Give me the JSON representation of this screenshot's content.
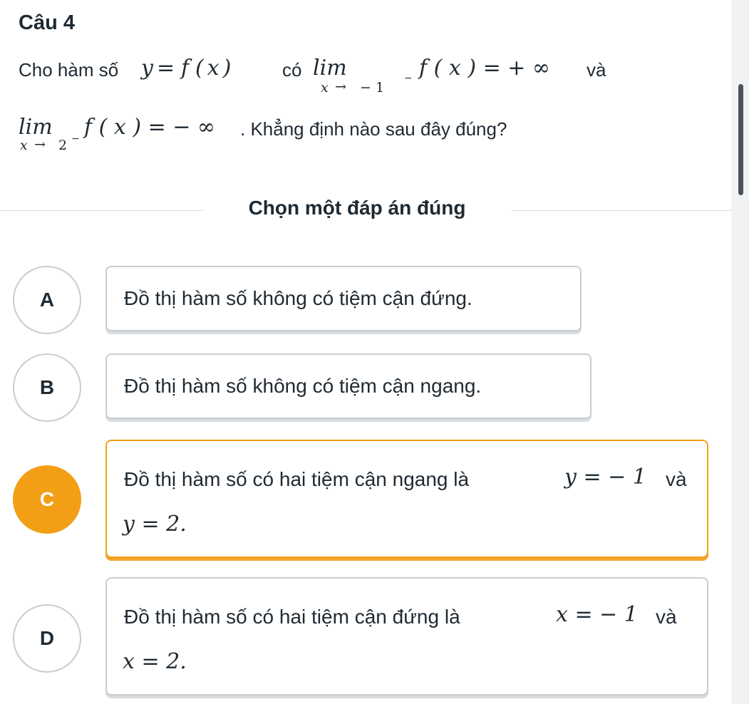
{
  "question": {
    "title": "Câu 4",
    "line1": {
      "prefix": "Cho hàm số",
      "func_y": "y",
      "func_eq": "=",
      "func_f": "f",
      "func_paren": "(x)",
      "connector": "có",
      "lim_word": "lim",
      "lim_sub_var": "x",
      "lim_sub_arrow": "→",
      "lim_sub_val": "− 1",
      "lim_sub_sign": "−",
      "expr": "f ( x ) = + ∞",
      "suffix": "và"
    },
    "line2": {
      "lim_word": "lim",
      "lim_sub_var": "x",
      "lim_sub_arrow": "→",
      "lim_sub_val": "2",
      "lim_sub_sign": "−",
      "expr": "f ( x ) = − ∞",
      "suffix": ". Khẳng định nào sau đây đúng?"
    }
  },
  "prompt": "Chọn một đáp án đúng",
  "options": [
    {
      "letter": "A",
      "text": "Đồ thị hàm số không có tiệm cận đứng.",
      "selected": false
    },
    {
      "letter": "B",
      "text": "Đồ thị hàm số không có tiệm cận ngang.",
      "selected": false
    },
    {
      "letter": "C",
      "text": "Đồ thị hàm số có hai tiệm cận ngang là",
      "math1": "y = − 1",
      "conj": "và",
      "math2": "y = 2.",
      "selected": true
    },
    {
      "letter": "D",
      "text": "Đồ thị hàm số có hai tiệm cận đứng là",
      "math1": "x = − 1",
      "conj": "và",
      "math2": "x = 2.",
      "selected": false
    }
  ],
  "colors": {
    "accent": "#f29f16",
    "border": "#c8cdd2",
    "text": "#1f2a33"
  }
}
